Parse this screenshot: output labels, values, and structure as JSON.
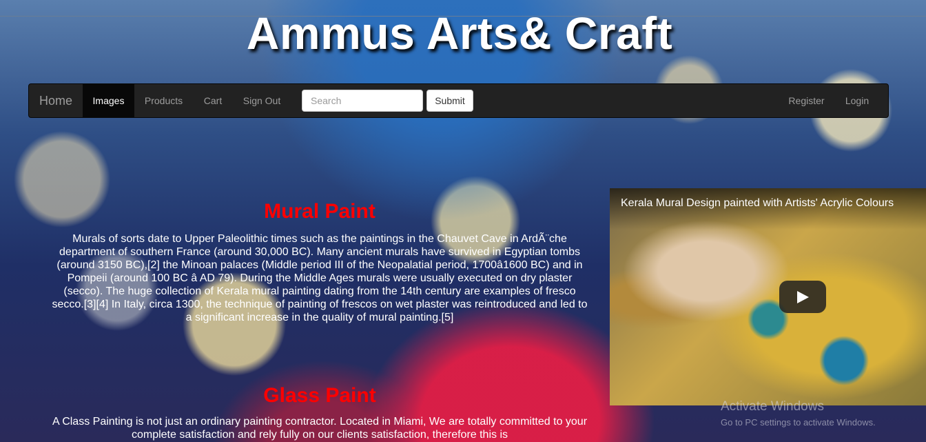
{
  "header": {
    "title": "Ammus Arts& Craft"
  },
  "nav": {
    "brand": "Home",
    "items": [
      "Images",
      "Products",
      "Cart",
      "Sign Out"
    ],
    "search_placeholder": "Search",
    "submit_label": "Submit",
    "right_items": [
      "Register",
      "Login"
    ],
    "active_item": "Images"
  },
  "sections": [
    {
      "title": "Mural Paint",
      "text": "Murals of sorts date to Upper Paleolithic times such as the paintings in the Chauvet Cave in ArdÃ¨che department of southern France (around 30,000 BC). Many ancient murals have survived in Egyptian tombs (around 3150 BC),[2] the Minoan palaces (Middle period III of the Neopalatial period, 1700â1600 BC) and in Pompeii (around 100 BC â AD 79). During the Middle Ages murals were usually executed on dry plaster (secco). The huge collection of Kerala mural painting dating from the 14th century are examples of fresco secco.[3][4] In Italy, circa 1300, the technique of painting of frescos on wet plaster was reintroduced and led to a significant increase in the quality of mural painting.[5]"
    },
    {
      "title": "Glass Paint",
      "text": "A Class Painting is not just an ordinary painting contractor. Located in Miami, We are totally committed to your complete satisfaction and rely fully on our clients satisfaction, therefore this is"
    }
  ],
  "video": {
    "title": "Kerala Mural Design painted with Artists' Acrylic Colours"
  },
  "watermark": {
    "title": "Activate Windows",
    "subtitle": "Go to PC settings to activate Windows."
  },
  "colors": {
    "nav_bg": "#222222",
    "nav_active_bg": "#080808",
    "section_title": "#ff0000",
    "text": "#ffffff"
  }
}
